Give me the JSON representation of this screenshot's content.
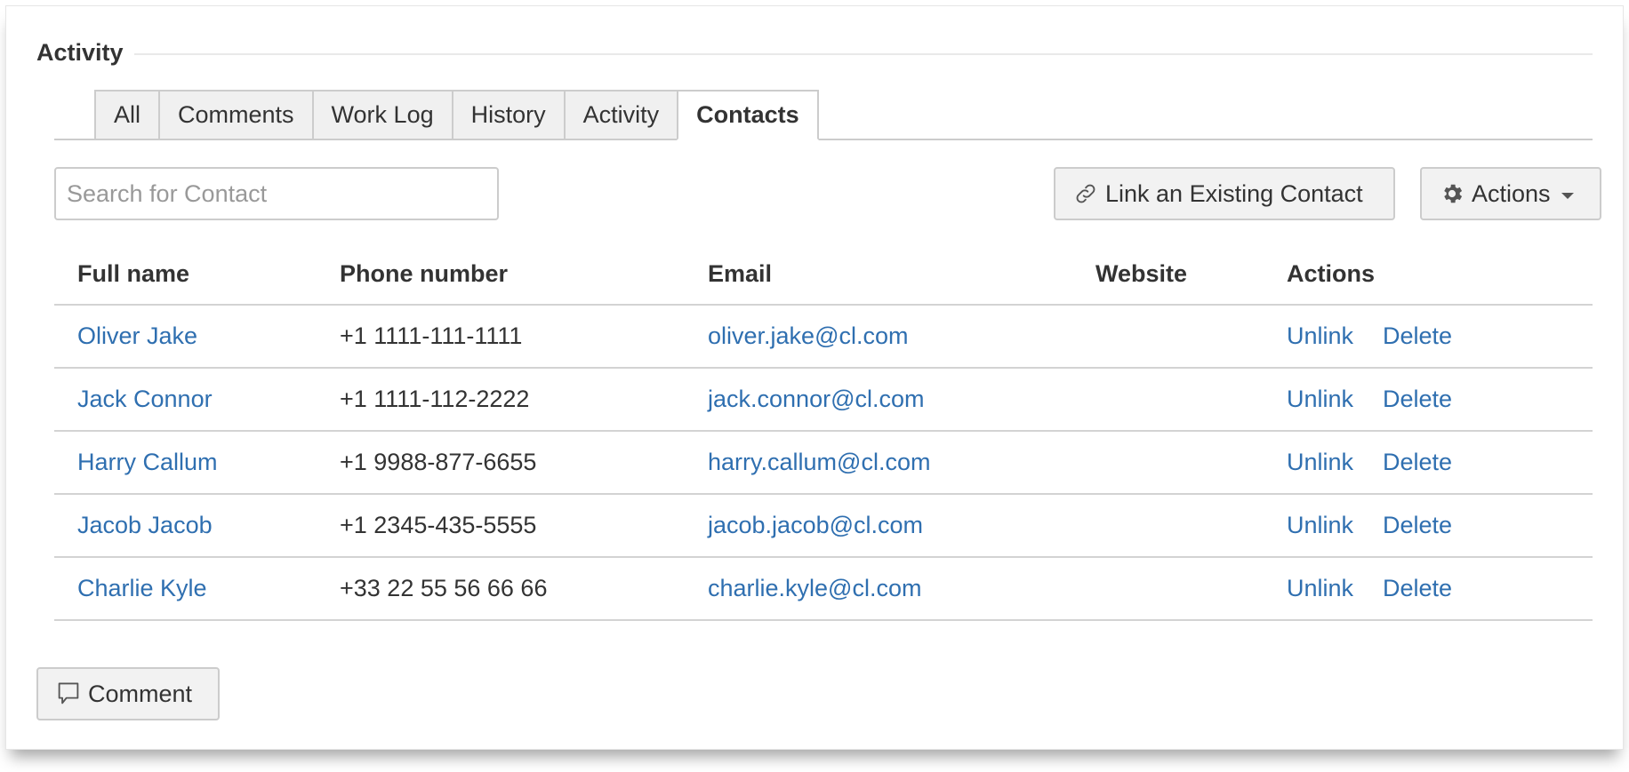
{
  "section": {
    "title": "Activity"
  },
  "tabs": [
    {
      "label": "All",
      "active": false
    },
    {
      "label": "Comments",
      "active": false
    },
    {
      "label": "Work Log",
      "active": false
    },
    {
      "label": "History",
      "active": false
    },
    {
      "label": "Activity",
      "active": false
    },
    {
      "label": "Contacts",
      "active": true
    }
  ],
  "toolbar": {
    "search_placeholder": "Search for Contact",
    "search_value": "",
    "link_contact_label": "Link an Existing Contact",
    "link_contact_icon": "link-icon",
    "actions_label": "Actions",
    "actions_icon": "gear-icon"
  },
  "table": {
    "columns": [
      "Full name",
      "Phone number",
      "Email",
      "Website",
      "Actions"
    ],
    "rows": [
      {
        "name": "Oliver Jake",
        "phone": "+1 1111-111-1111",
        "email": "oliver.jake@cl.com",
        "website": "",
        "unlink": "Unlink",
        "delete": "Delete"
      },
      {
        "name": "Jack Connor",
        "phone": "+1 1111-112-2222",
        "email": "jack.connor@cl.com",
        "website": "",
        "unlink": "Unlink",
        "delete": "Delete"
      },
      {
        "name": "Harry Callum",
        "phone": "+1 9988-877-6655",
        "email": "harry.callum@cl.com",
        "website": "",
        "unlink": "Unlink",
        "delete": "Delete"
      },
      {
        "name": "Jacob Jacob",
        "phone": "+1 2345-435-5555",
        "email": "jacob.jacob@cl.com",
        "website": "",
        "unlink": "Unlink",
        "delete": "Delete"
      },
      {
        "name": "Charlie Kyle",
        "phone": "+33 22 55 56 66 66",
        "email": "charlie.kyle@cl.com",
        "website": "",
        "unlink": "Unlink",
        "delete": "Delete"
      }
    ]
  },
  "footer": {
    "comment_label": "Comment",
    "comment_icon": "speech-bubble-icon"
  },
  "colors": {
    "link": "#2f6fb0",
    "text": "#333333",
    "border": "#cccccc",
    "button_bg": "#f2f2f2",
    "tab_bg": "#f0f0f0"
  }
}
